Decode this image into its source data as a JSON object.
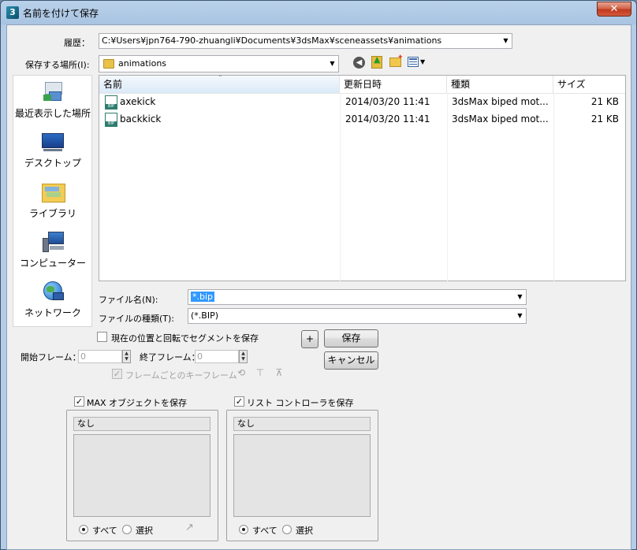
{
  "window": {
    "title": "名前を付けて保存",
    "close_label": "✕"
  },
  "history": {
    "label": "履歴：",
    "value": "C:¥Users¥jpn764-790-zhuangli¥Documents¥3dsMax¥sceneassets¥animations"
  },
  "location": {
    "label": "保存する場所(I):",
    "value": "animations"
  },
  "places": [
    {
      "label": "最近表示した場所"
    },
    {
      "label": "デスクトップ"
    },
    {
      "label": "ライブラリ"
    },
    {
      "label": "コンピューター"
    },
    {
      "label": "ネットワーク"
    }
  ],
  "columns": {
    "name": "名前",
    "date": "更新日時",
    "type": "種類",
    "size": "サイズ"
  },
  "files": [
    {
      "name": "axekick",
      "date": "2014/03/20 11:41",
      "type": "3dsMax biped mot...",
      "size": "21 KB"
    },
    {
      "name": "backkick",
      "date": "2014/03/20 11:41",
      "type": "3dsMax biped mot...",
      "size": "21 KB"
    }
  ],
  "filename": {
    "label": "ファイル名(N):",
    "value": "*.bip"
  },
  "filetype": {
    "label": "ファイルの種類(T):",
    "value": "(*.BIP)"
  },
  "segment": {
    "label": "現在の位置と回転でセグメントを保存",
    "plus_label": "+"
  },
  "frames": {
    "start_label": "開始フレーム：",
    "start_value": "0",
    "end_label": "終了フレーム：",
    "end_value": "0",
    "per_frame_label": "フレームごとのキーフレーム"
  },
  "buttons": {
    "save": "保存",
    "cancel": "キャンセル"
  },
  "max_group": {
    "label": "MAX オブジェクトを保存",
    "list_head": "なし",
    "all_label": "すべて",
    "select_label": "選択"
  },
  "list_group": {
    "label": "リスト コントローラを保存",
    "list_head": "なし",
    "all_label": "すべて",
    "select_label": "選択"
  }
}
